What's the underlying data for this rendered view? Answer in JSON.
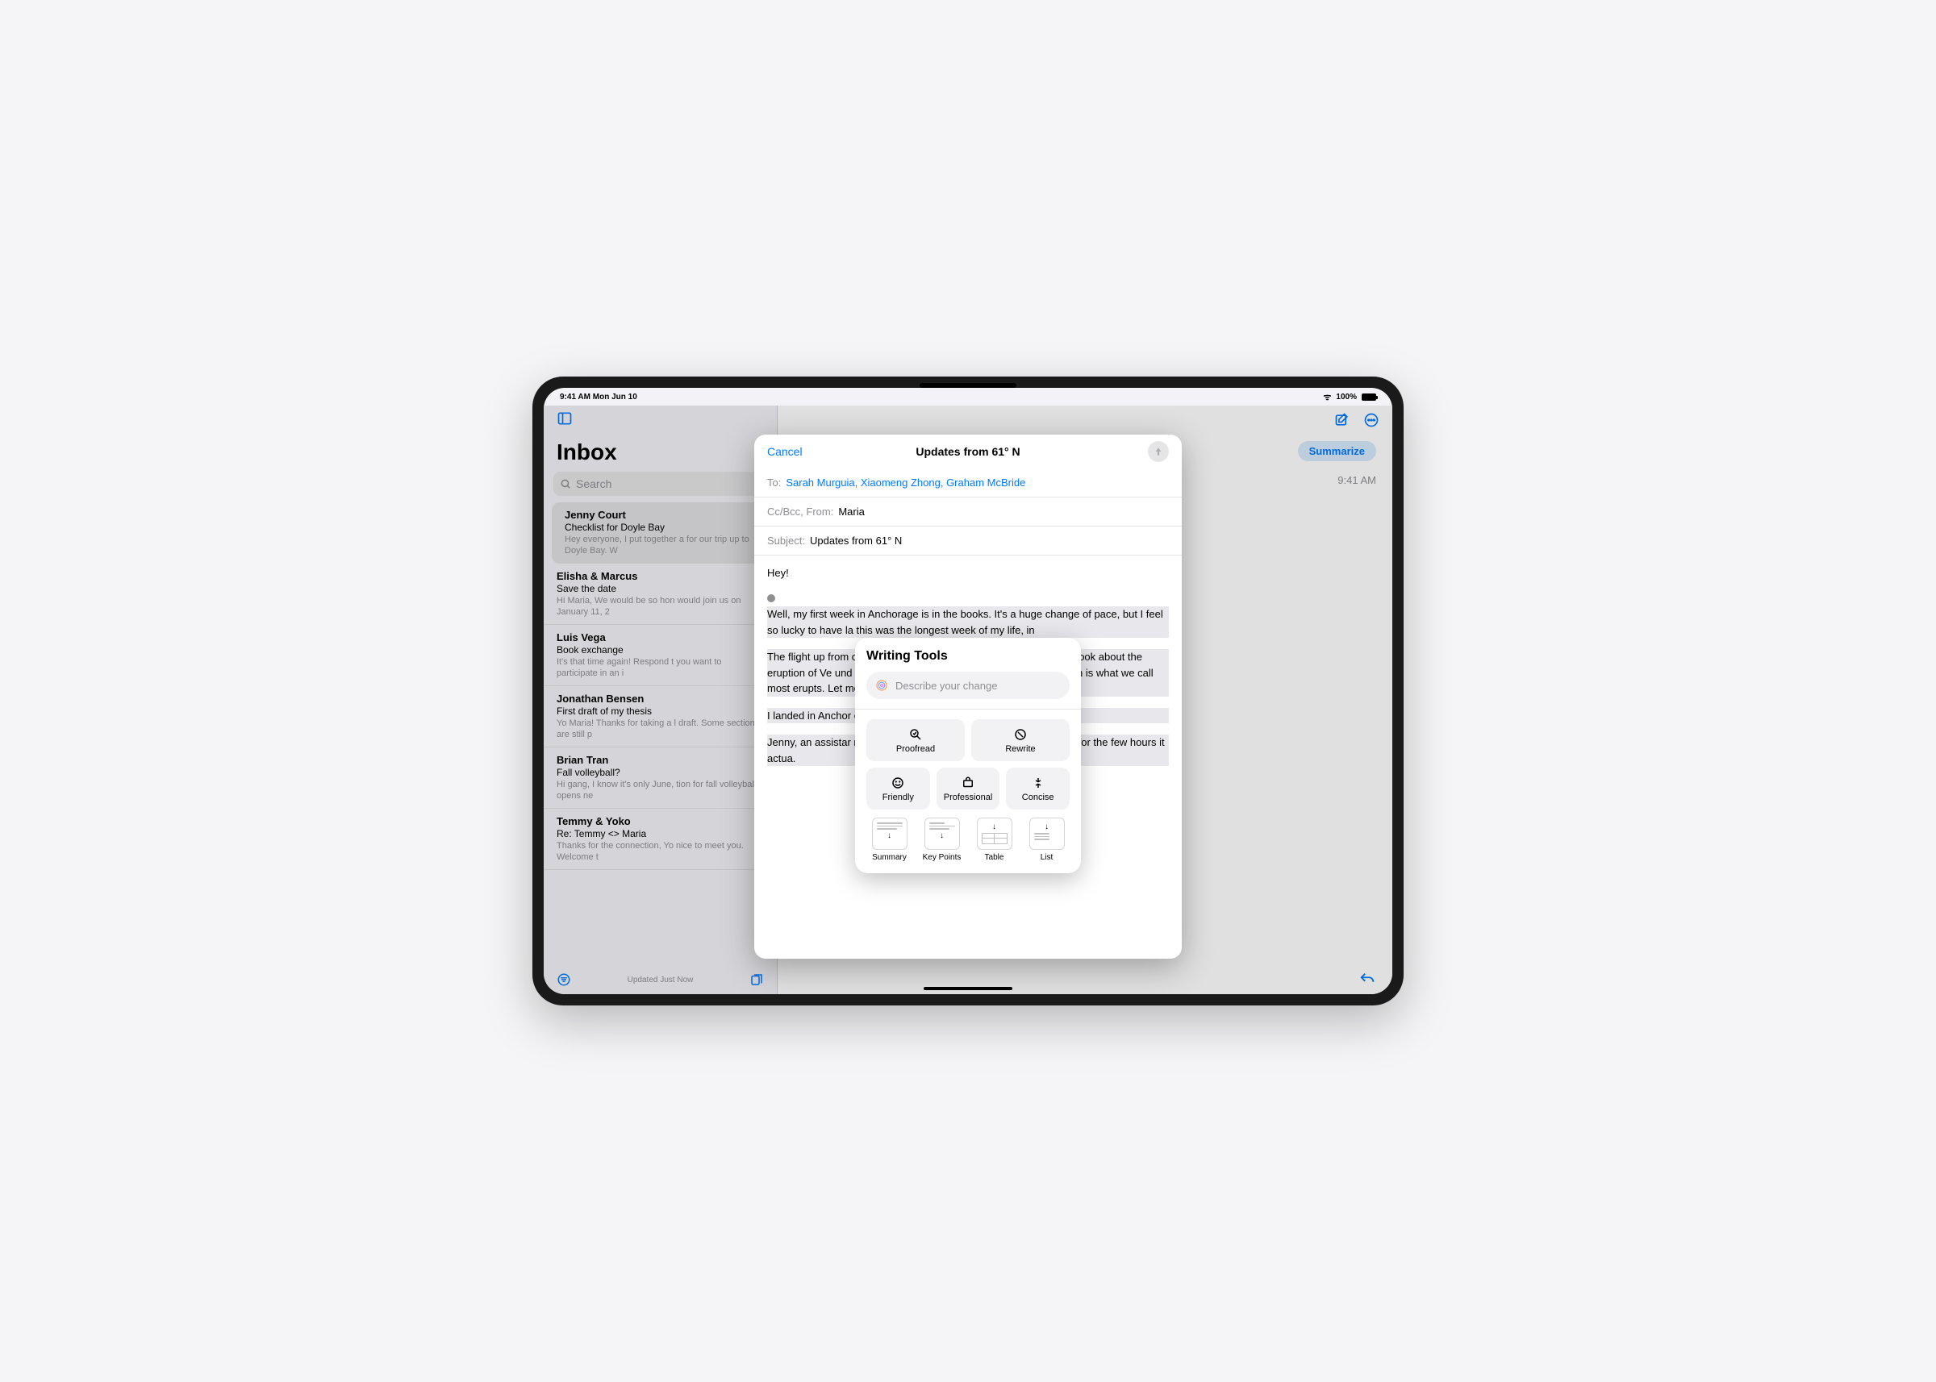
{
  "status": {
    "time_day": "9:41 AM   Mon Jun 10",
    "battery": "100%"
  },
  "sidebar": {
    "title": "Inbox",
    "search_placeholder": "Search",
    "footer": "Updated Just Now"
  },
  "messages": [
    {
      "sender": "Jenny Court",
      "subject": "Checklist for Doyle Bay",
      "preview": "Hey everyone, I put together a for our trip up to Doyle Bay. W"
    },
    {
      "sender": "Elisha & Marcus",
      "subject": "Save the date",
      "preview": "Hi Maria, We would be so hon would join us on January 11, 2"
    },
    {
      "sender": "Luis Vega",
      "subject": "Book exchange",
      "preview": "It's that time again! Respond t you want to participate in an i"
    },
    {
      "sender": "Jonathan Bensen",
      "subject": "First draft of my thesis",
      "preview": "Yo Maria! Thanks for taking a l draft. Some sections are still p"
    },
    {
      "sender": "Brian Tran",
      "subject": "Fall volleyball?",
      "preview": "Hi gang, I know it's only June, tion for fall volleyball opens ne"
    },
    {
      "sender": "Temmy & Yoko",
      "subject": "Re: Temmy <> Maria",
      "preview": "Thanks for the connection, Yo nice to meet you. Welcome t"
    }
  ],
  "main": {
    "summarize": "Summarize",
    "time": "9:41 AM"
  },
  "compose": {
    "cancel": "Cancel",
    "title": "Updates from 61° N",
    "to_label": "To:",
    "to_value": "Sarah Murguia, Xiaomeng Zhong, Graham McBride",
    "ccbcc_label": "Cc/Bcc, From:",
    "ccbcc_value": "Maria",
    "subject_label": "Subject:",
    "subject_value": "Updates from 61° N",
    "greeting": "Hey!",
    "para1": "Well, my first week in Anchorage is in the books. It's a huge change of pace, but I feel so lucky to have la                                                                         this was the longest week of my life, in",
    "para2": "The flight up from                                                                    of the flight reading. I've been on a hist                                                                     tty solid book about the eruption of Ve                                                                  und Pompeii. It's a little dry at points                                                                      rd: tephra, which is what we call most                                                                   erupts. Let me know if you find a way t",
    "para3": "I landed in Anchor                                                                     ould still be out, it was so trippy to s",
    "para4": "Jenny, an assistar                                                                     ne airport. She told me the first thing                                                                   ly sleeping for the few hours it actua."
  },
  "wt": {
    "title": "Writing Tools",
    "placeholder": "Describe your change",
    "proofread": "Proofread",
    "rewrite": "Rewrite",
    "friendly": "Friendly",
    "professional": "Professional",
    "concise": "Concise",
    "summary": "Summary",
    "keypoints": "Key Points",
    "table": "Table",
    "list": "List"
  }
}
